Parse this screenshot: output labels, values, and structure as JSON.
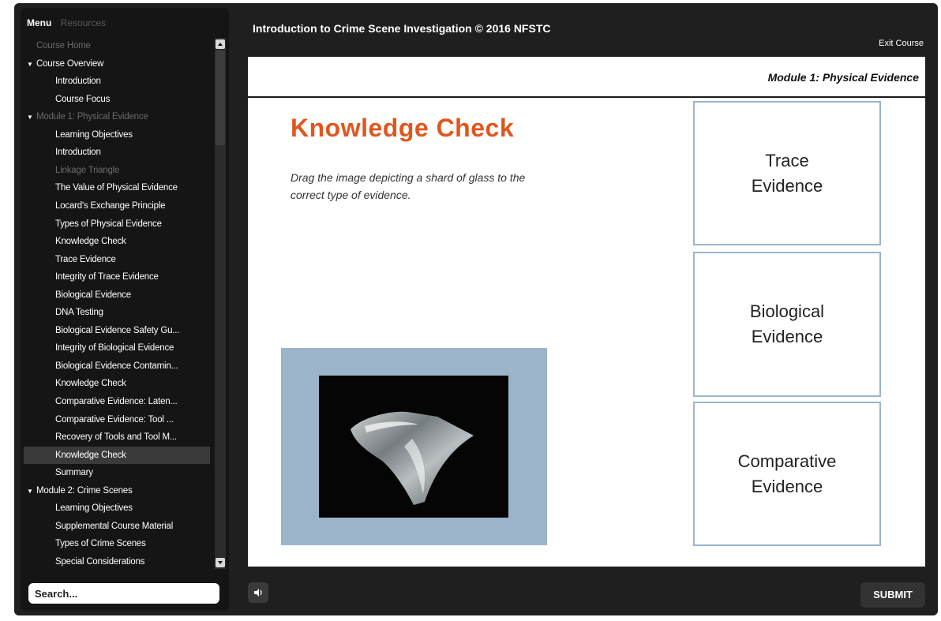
{
  "colors": {
    "accent": "#e0561e",
    "drop_border": "#9ab5cf",
    "drag_panel": "#9cb4c9",
    "player_bg": "#1f1f1f"
  },
  "sidebar": {
    "tabs": [
      "Menu",
      "Resources"
    ],
    "items": [
      {
        "label": "Course Home",
        "level": "section",
        "state": "dim",
        "caret": ""
      },
      {
        "label": "Course Overview",
        "level": "section",
        "state": "normal",
        "caret": "▼"
      },
      {
        "label": "Introduction",
        "level": "sub",
        "state": "normal",
        "caret": ""
      },
      {
        "label": "Course Focus",
        "level": "sub",
        "state": "normal",
        "caret": ""
      },
      {
        "label": "Module 1:  Physical Evidence",
        "level": "section",
        "state": "dim",
        "caret": "▼"
      },
      {
        "label": "Learning Objectives",
        "level": "sub",
        "state": "normal",
        "caret": ""
      },
      {
        "label": "Introduction",
        "level": "sub",
        "state": "normal",
        "caret": ""
      },
      {
        "label": "Linkage Triangle",
        "level": "sub",
        "state": "dim",
        "caret": ""
      },
      {
        "label": "The Value of Physical Evidence",
        "level": "sub",
        "state": "normal",
        "caret": ""
      },
      {
        "label": "Locard's Exchange Principle",
        "level": "sub",
        "state": "normal",
        "caret": ""
      },
      {
        "label": "Types of Physical Evidence",
        "level": "sub",
        "state": "normal",
        "caret": ""
      },
      {
        "label": "Knowledge Check",
        "level": "sub",
        "state": "normal",
        "caret": ""
      },
      {
        "label": "Trace Evidence",
        "level": "sub",
        "state": "normal",
        "caret": ""
      },
      {
        "label": "Integrity of Trace Evidence",
        "level": "sub",
        "state": "normal",
        "caret": ""
      },
      {
        "label": "Biological Evidence",
        "level": "sub",
        "state": "normal",
        "caret": ""
      },
      {
        "label": "DNA Testing",
        "level": "sub",
        "state": "normal",
        "caret": ""
      },
      {
        "label": "Biological Evidence Safety Gu...",
        "level": "sub",
        "state": "normal",
        "caret": ""
      },
      {
        "label": "Integrity of Biological Evidence",
        "level": "sub",
        "state": "normal",
        "caret": ""
      },
      {
        "label": "Biological Evidence Contamin...",
        "level": "sub",
        "state": "normal",
        "caret": ""
      },
      {
        "label": "Knowledge Check",
        "level": "sub",
        "state": "normal",
        "caret": ""
      },
      {
        "label": "Comparative Evidence:  Laten...",
        "level": "sub",
        "state": "normal",
        "caret": ""
      },
      {
        "label": "Comparative Evidence:  Tool ...",
        "level": "sub",
        "state": "normal",
        "caret": ""
      },
      {
        "label": "Recovery of Tools and Tool M...",
        "level": "sub",
        "state": "normal",
        "caret": ""
      },
      {
        "label": "Knowledge Check",
        "level": "sub",
        "state": "selected",
        "caret": ""
      },
      {
        "label": "Summary",
        "level": "sub",
        "state": "normal",
        "caret": ""
      },
      {
        "label": "Module 2:  Crime Scenes",
        "level": "section",
        "state": "normal",
        "caret": "▼"
      },
      {
        "label": "Learning Objectives",
        "level": "sub",
        "state": "normal",
        "caret": ""
      },
      {
        "label": "Supplemental Course Material",
        "level": "sub",
        "state": "normal",
        "caret": ""
      },
      {
        "label": "Types of Crime Scenes",
        "level": "sub",
        "state": "normal",
        "caret": ""
      },
      {
        "label": "Special Considerations",
        "level": "sub",
        "state": "normal",
        "caret": ""
      }
    ],
    "search_placeholder": "Search..."
  },
  "header": {
    "course_title": "Introduction to Crime Scene Investigation © 2016 NFSTC",
    "exit_label": "Exit Course"
  },
  "slide": {
    "module_label": "Module 1:  Physical Evidence",
    "title": "Knowledge Check",
    "instruction": "Drag the image depicting a shard of glass to the correct type of evidence.",
    "drag_image_icon": "glass-shard-photo",
    "targets": [
      "Trace Evidence",
      "Biological Evidence",
      "Comparative Evidence"
    ]
  },
  "footer": {
    "audio_icon": "speaker-icon",
    "submit_label": "SUBMIT"
  }
}
